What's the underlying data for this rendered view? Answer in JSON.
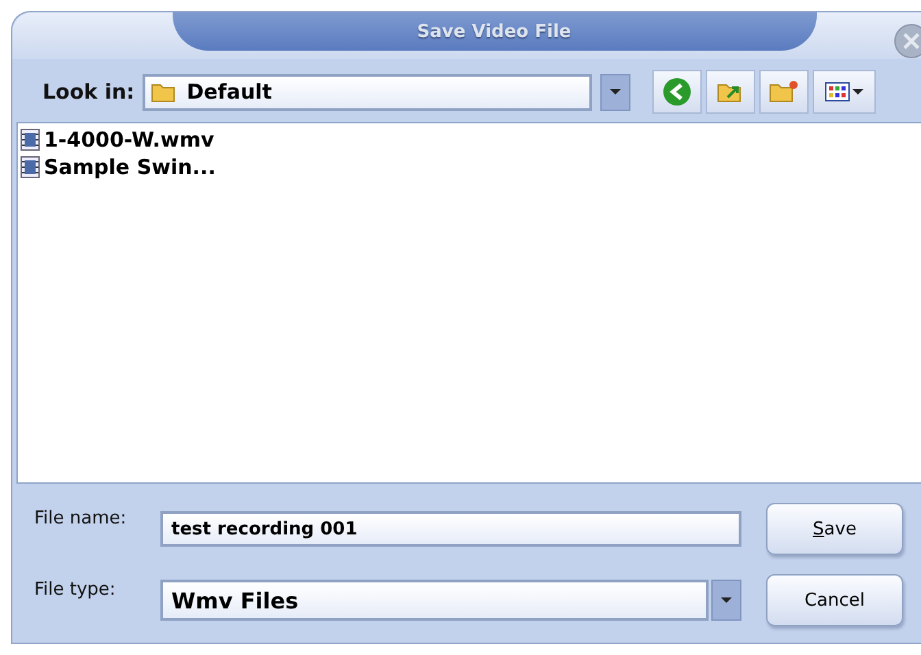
{
  "window": {
    "title": "Save Video File"
  },
  "look_in": {
    "label": "Look in:",
    "value": "Default"
  },
  "files": [
    {
      "name": "1-4000-W.wmv"
    },
    {
      "name": "Sample Swin..."
    }
  ],
  "file_name": {
    "label": "File name:",
    "value": "test recording 001"
  },
  "file_type": {
    "label": "File type:",
    "value": "Wmv Files"
  },
  "buttons": [
    {
      "label": "Save",
      "first_letter_underlined": true
    },
    {
      "label": "Cancel"
    }
  ]
}
